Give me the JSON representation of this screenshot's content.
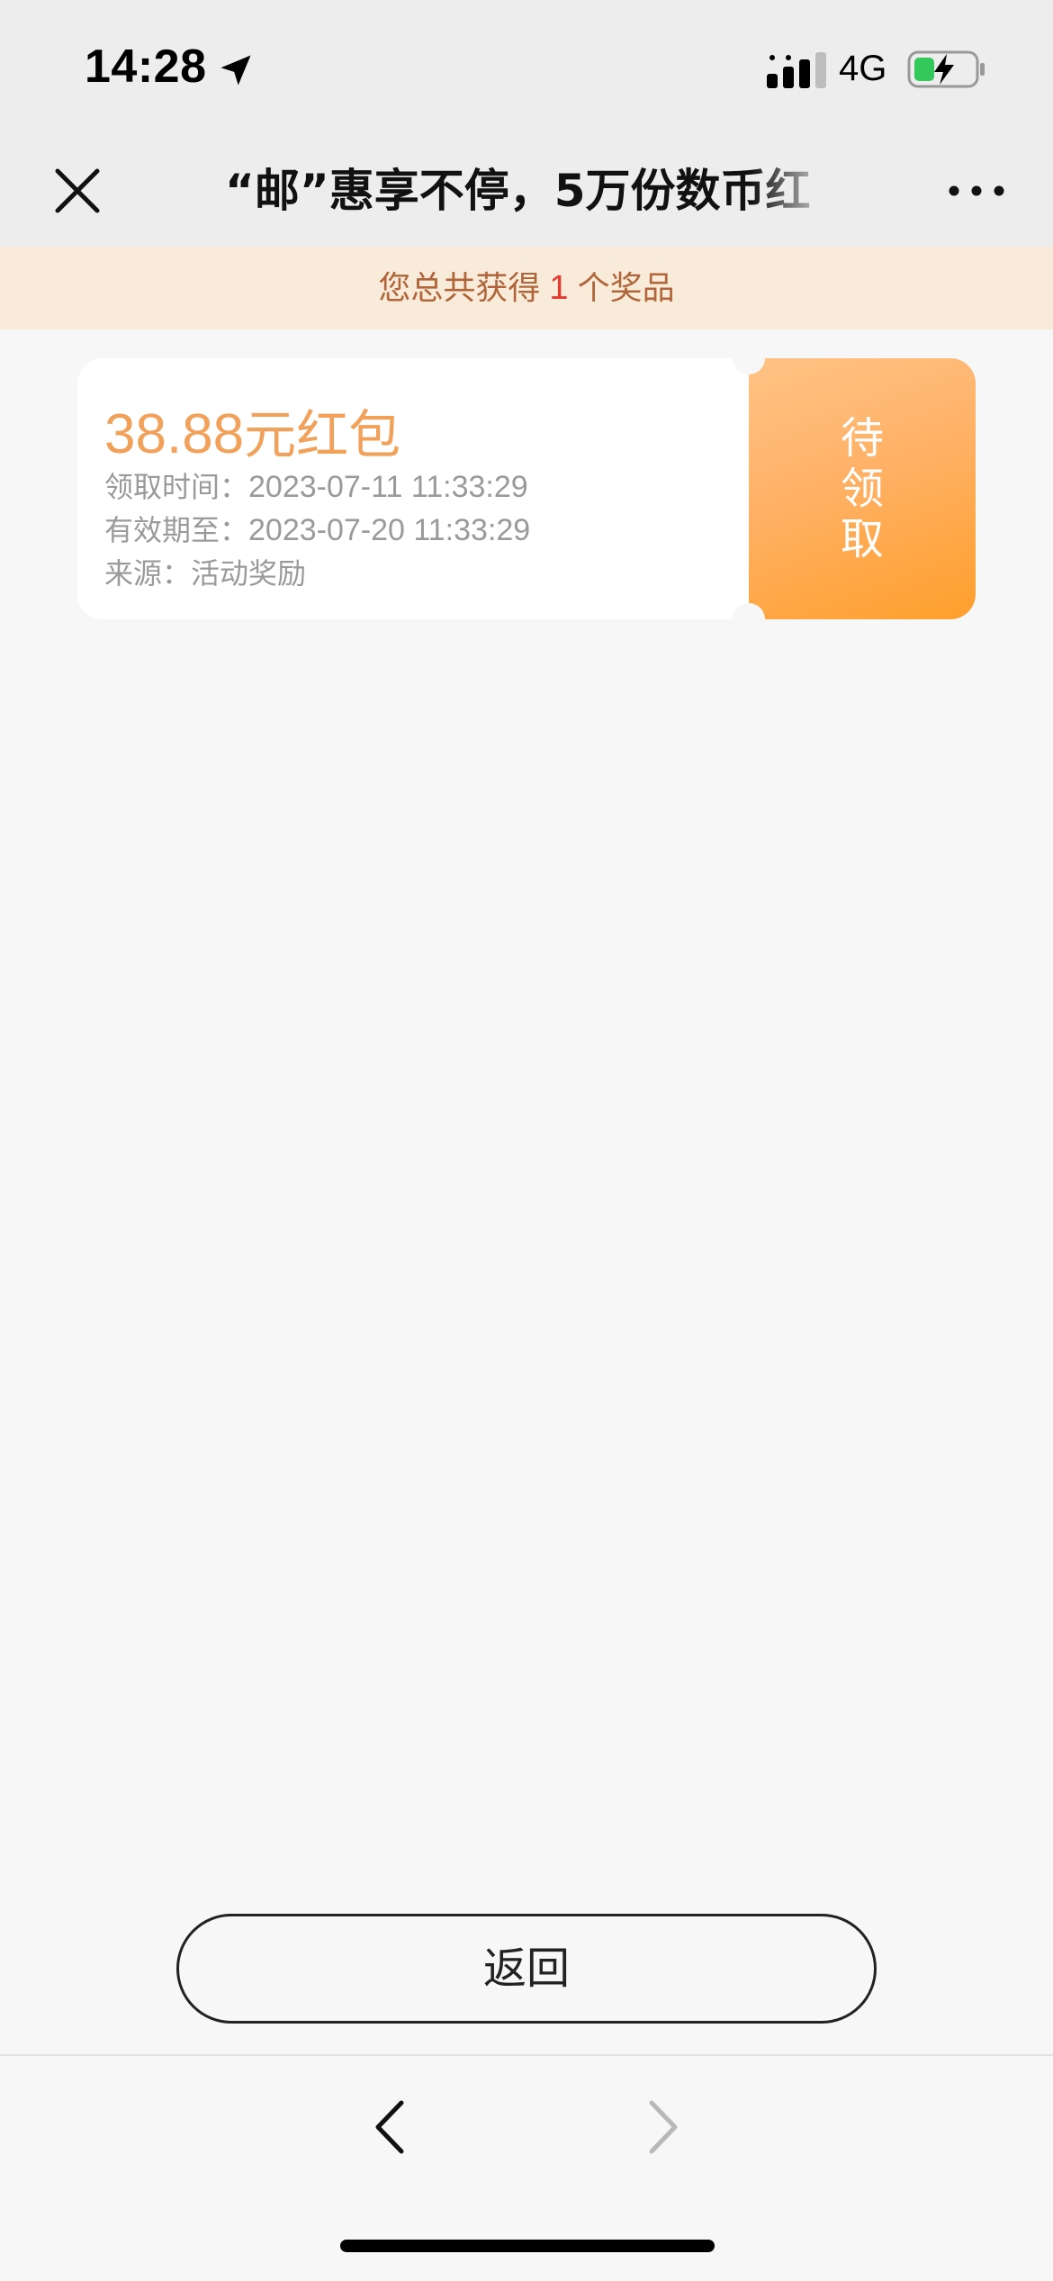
{
  "status_bar": {
    "time": "14:28",
    "network": "4G",
    "icons": [
      "location-arrow-icon",
      "signal-icon",
      "battery-charging-icon"
    ]
  },
  "nav": {
    "title": "“邮”惠享不停，5万份数币红",
    "icons": [
      "close-icon",
      "more-icon"
    ]
  },
  "summary": {
    "prefix": "您总共获得",
    "count": "1",
    "suffix": "个奖品"
  },
  "prize": {
    "amount": "38.88",
    "name_suffix": "元红包",
    "claim_time_label": "领取时间：",
    "claim_time_value": "2023-07-11 11:33:29",
    "expiry_label": "有效期至：",
    "expiry_value": "2023-07-20 11:33:29",
    "source_label": "来源：",
    "source_value": "活动奖励",
    "status": "待领取"
  },
  "actions": {
    "back_label": "返回"
  },
  "toolbar": {
    "icons": [
      "chevron-left-icon",
      "chevron-right-icon"
    ]
  },
  "colors": {
    "accent_orange": "#f2a15a",
    "stub_gradient_start": "#ffc386",
    "stub_gradient_end": "#ff9f2c",
    "banner_bg": "#f9ebd9",
    "banner_text": "#b0663a",
    "count_red": "#e63a2e"
  }
}
